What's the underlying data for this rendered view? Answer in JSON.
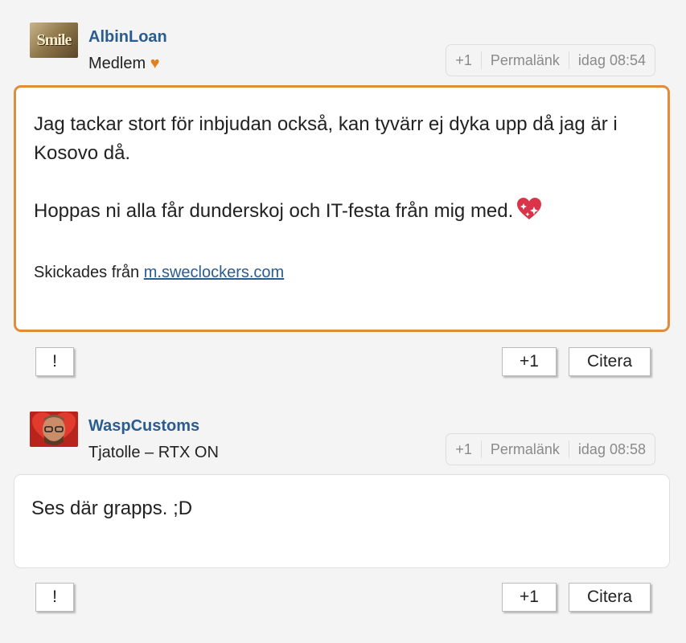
{
  "posts": [
    {
      "username": "AlbinLoan",
      "user_title": "Medlem",
      "title_icon": "♥",
      "avatar_text": "Smile",
      "meta": {
        "plus_one": "+1",
        "permalink": "Permalänk",
        "timestamp": "idag 08:54"
      },
      "body": {
        "paragraph_1": "Jag tackar stort för inbjudan också, kan tyvärr ej dyka upp då jag är i Kosovo då.",
        "paragraph_2": "Hoppas ni alla får dunderskoj och IT-festa från mig med.",
        "emoji": "sparkling-heart-icon",
        "sent_from_prefix": "Skickades från ",
        "sent_from_link": "m.sweclockers.com"
      },
      "actions": {
        "report": "!",
        "plus_one": "+1",
        "quote": "Citera"
      },
      "highlight_color": "#df8d3a"
    },
    {
      "username": "WaspCustoms",
      "user_title": "Tjatolle – RTX ON",
      "meta": {
        "plus_one": "+1",
        "permalink": "Permalänk",
        "timestamp": "idag 08:58"
      },
      "body": {
        "paragraph_1": "Ses där grapps. ;D"
      },
      "actions": {
        "report": "!",
        "plus_one": "+1",
        "quote": "Citera"
      }
    }
  ],
  "colors": {
    "username": "#2a5d8f",
    "link": "#2a5d8f",
    "accent": "#e0801e",
    "muted": "#8a8a8a"
  }
}
